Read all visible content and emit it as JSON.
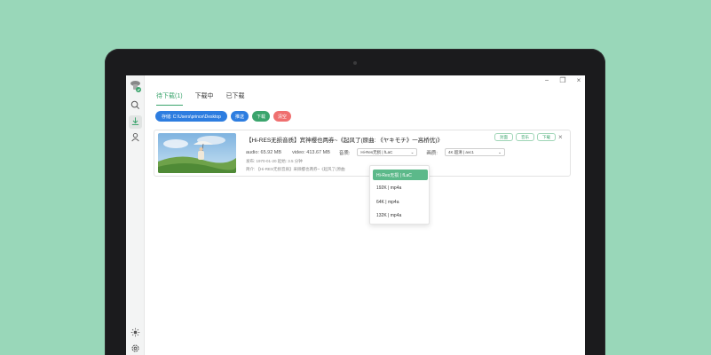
{
  "window": {
    "minimize": "−",
    "maximize": "❐",
    "close": "×"
  },
  "sidebar": {
    "items": [
      {
        "icon": "search-icon"
      },
      {
        "icon": "download-icon"
      },
      {
        "icon": "user-icon"
      }
    ],
    "bottom": [
      {
        "icon": "theme-icon"
      },
      {
        "icon": "settings-icon"
      }
    ]
  },
  "tabs": [
    {
      "label": "待下载(1)"
    },
    {
      "label": "下载中"
    },
    {
      "label": "已下载"
    }
  ],
  "toolbar": {
    "path_label": "存储: C:\\Users\\prince\\Desktop",
    "push_label": "推送",
    "download_label": "下载",
    "clear_label": "清空"
  },
  "item": {
    "title": "【Hi-RES无损音质】宾神樱也两券~《起风了(原曲: 《ヤキモチ》一高桥优)》",
    "tags": [
      "封面",
      "音乐",
      "下载"
    ],
    "audio_label": "audio: 65.92 MB",
    "video_label": "video: 413.67 MB",
    "audio_quality_label": "音质:",
    "audio_quality_value": "Hi-Res无损 | fLaC",
    "video_quality_label": "画质:",
    "video_quality_value": "4K 超清 | avc1",
    "info_line1": "发布: 1970-01-20 起始: 3.5 分钟",
    "info_line2": "简介: 【Hi-RES无损音质】采撷樱也两券~《起风了(原曲",
    "audio_options": [
      {
        "label": "Hi-Res无损 | fLaC",
        "selected": true
      },
      {
        "label": "192K | mp4a",
        "selected": false
      },
      {
        "label": "64K | mp4a",
        "selected": false
      },
      {
        "label": "132K | mp4a",
        "selected": false
      }
    ]
  },
  "colors": {
    "background": "#99d7b9",
    "accent_green": "#3aa46c",
    "accent_blue": "#2d7de0",
    "accent_red": "#ef6f6f"
  }
}
